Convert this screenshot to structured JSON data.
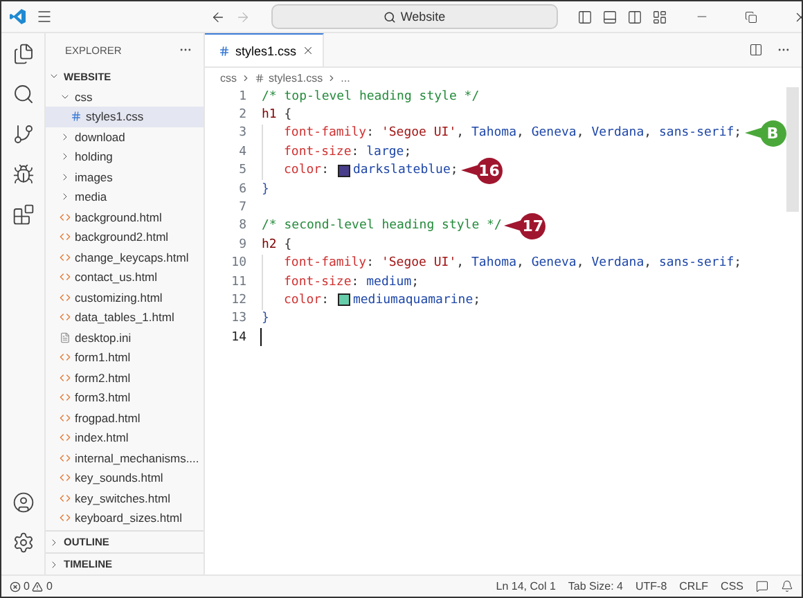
{
  "title_bar": {
    "search": "Website"
  },
  "explorer": {
    "title": "EXPLORER",
    "root": {
      "label": "WEBSITE",
      "expanded": true,
      "children": [
        {
          "label": "css",
          "kind": "folder",
          "expanded": true,
          "selected": false,
          "children": [
            {
              "label": "styles1.css",
              "kind": "css",
              "selected": true
            }
          ]
        },
        {
          "label": "download",
          "kind": "folder",
          "expanded": false,
          "selected": false
        },
        {
          "label": "holding",
          "kind": "folder",
          "expanded": false,
          "selected": false
        },
        {
          "label": "images",
          "kind": "folder",
          "expanded": false,
          "selected": false
        },
        {
          "label": "media",
          "kind": "folder",
          "expanded": false,
          "selected": false
        },
        {
          "label": "background.html",
          "kind": "html",
          "selected": false
        },
        {
          "label": "background2.html",
          "kind": "html",
          "selected": false
        },
        {
          "label": "change_keycaps.html",
          "kind": "html",
          "selected": false
        },
        {
          "label": "contact_us.html",
          "kind": "html",
          "selected": false
        },
        {
          "label": "customizing.html",
          "kind": "html",
          "selected": false
        },
        {
          "label": "data_tables_1.html",
          "kind": "html",
          "selected": false
        },
        {
          "label": "desktop.ini",
          "kind": "text",
          "selected": false
        },
        {
          "label": "form1.html",
          "kind": "html",
          "selected": false
        },
        {
          "label": "form2.html",
          "kind": "html",
          "selected": false
        },
        {
          "label": "form3.html",
          "kind": "html",
          "selected": false
        },
        {
          "label": "frogpad.html",
          "kind": "html",
          "selected": false
        },
        {
          "label": "index.html",
          "kind": "html",
          "selected": false
        },
        {
          "label": "internal_mechanisms....",
          "kind": "html",
          "selected": false
        },
        {
          "label": "key_sounds.html",
          "kind": "html",
          "selected": false
        },
        {
          "label": "key_switches.html",
          "kind": "html",
          "selected": false
        },
        {
          "label": "keyboard_sizes.html",
          "kind": "html",
          "selected": false
        }
      ]
    },
    "sections": [
      {
        "label": "OUTLINE",
        "expanded": false
      },
      {
        "label": "TIMELINE",
        "expanded": false
      }
    ]
  },
  "editor": {
    "tabs": [
      {
        "label": "styles1.css",
        "selected": true
      }
    ],
    "breadcrumb": [
      "css",
      "styles1.css",
      "..."
    ],
    "lines": [
      {
        "number": "1",
        "indented": false,
        "tokens": [
          {
            "kind": "comment",
            "text": "/* top-level heading style */"
          }
        ]
      },
      {
        "number": "2",
        "indented": false,
        "tokens": [
          {
            "kind": "selector",
            "text": "h1"
          },
          {
            "kind": "punct",
            "text": " {"
          }
        ]
      },
      {
        "number": "3",
        "indented": true,
        "tokens": [
          {
            "kind": "property",
            "text": "font-family"
          },
          {
            "kind": "punct",
            "text": ": "
          },
          {
            "kind": "string",
            "text": "'Segoe UI'"
          },
          {
            "kind": "punct",
            "text": ", "
          },
          {
            "kind": "value",
            "text": "Tahoma"
          },
          {
            "kind": "punct",
            "text": ", "
          },
          {
            "kind": "value",
            "text": "Geneva"
          },
          {
            "kind": "punct",
            "text": ", "
          },
          {
            "kind": "value",
            "text": "Verdana"
          },
          {
            "kind": "punct",
            "text": ", "
          },
          {
            "kind": "value",
            "text": "sans-serif"
          },
          {
            "kind": "punct",
            "text": ";"
          }
        ],
        "callout": {
          "label": "B",
          "color": "#4aa83a"
        }
      },
      {
        "number": "4",
        "indented": true,
        "tokens": [
          {
            "kind": "property",
            "text": "font-size"
          },
          {
            "kind": "punct",
            "text": ": "
          },
          {
            "kind": "value",
            "text": "large"
          },
          {
            "kind": "punct",
            "text": ";"
          }
        ]
      },
      {
        "number": "5",
        "indented": true,
        "tokens": [
          {
            "kind": "property",
            "text": "color"
          },
          {
            "kind": "punct",
            "text": ": "
          },
          {
            "kind": "swatch",
            "color": "#483d8b"
          },
          {
            "kind": "value",
            "text": "darkslateblue"
          },
          {
            "kind": "punct",
            "text": ";"
          }
        ],
        "callout": {
          "label": "16",
          "color": "#a0162e"
        }
      },
      {
        "number": "6",
        "indented": false,
        "tokens": [
          {
            "kind": "selector_punct",
            "text": "}"
          }
        ]
      },
      {
        "number": "7",
        "indented": false
      },
      {
        "number": "8",
        "indented": false,
        "tokens": [
          {
            "kind": "comment",
            "text": "/* second-level heading style */"
          }
        ],
        "callout": {
          "label": "17",
          "color": "#a0162e"
        }
      },
      {
        "number": "9",
        "indented": false,
        "tokens": [
          {
            "kind": "selector",
            "text": "h2"
          },
          {
            "kind": "punct",
            "text": " {"
          }
        ]
      },
      {
        "number": "10",
        "indented": true,
        "tokens": [
          {
            "kind": "property",
            "text": "font-family"
          },
          {
            "kind": "punct",
            "text": ": "
          },
          {
            "kind": "string",
            "text": "'Segoe UI'"
          },
          {
            "kind": "punct",
            "text": ", "
          },
          {
            "kind": "value",
            "text": "Tahoma"
          },
          {
            "kind": "punct",
            "text": ", "
          },
          {
            "kind": "value",
            "text": "Geneva"
          },
          {
            "kind": "punct",
            "text": ", "
          },
          {
            "kind": "value",
            "text": "Verdana"
          },
          {
            "kind": "punct",
            "text": ", "
          },
          {
            "kind": "value",
            "text": "sans-serif"
          },
          {
            "kind": "punct",
            "text": ";"
          }
        ]
      },
      {
        "number": "11",
        "indented": true,
        "tokens": [
          {
            "kind": "property",
            "text": "font-size"
          },
          {
            "kind": "punct",
            "text": ": "
          },
          {
            "kind": "value",
            "text": "medium"
          },
          {
            "kind": "punct",
            "text": ";"
          }
        ]
      },
      {
        "number": "12",
        "indented": true,
        "tokens": [
          {
            "kind": "property",
            "text": "color"
          },
          {
            "kind": "punct",
            "text": ": "
          },
          {
            "kind": "swatch",
            "color": "#66cdaa"
          },
          {
            "kind": "value",
            "text": "mediumaquamarine"
          },
          {
            "kind": "punct",
            "text": ";"
          }
        ]
      },
      {
        "number": "13",
        "indented": false,
        "tokens": [
          {
            "kind": "selector_punct",
            "text": "}"
          }
        ]
      },
      {
        "number": "14",
        "indented": false,
        "current": true
      }
    ]
  },
  "status_bar": {
    "errors": "0",
    "warnings": "0",
    "items": [
      "Ln 14, Col 1",
      "Tab Size: 4",
      "UTF-8",
      "CRLF",
      "CSS"
    ]
  }
}
